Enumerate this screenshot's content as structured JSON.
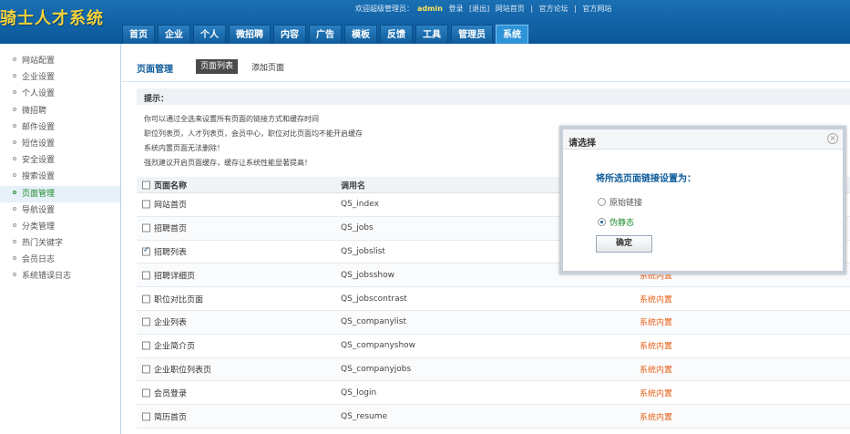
{
  "app": {
    "logo": "骑士人才系统"
  },
  "topbar": {
    "welcome": "欢迎超级管理员：",
    "admin_name": "admin",
    "login": "登录",
    "logout": "[退出]",
    "links": [
      "网站首页",
      "|",
      "官方论坛",
      "|",
      "官方网站"
    ]
  },
  "nav": [
    "首页",
    "企业",
    "个人",
    "微招聘",
    "内容",
    "广告",
    "模板",
    "反馈",
    "工具",
    "管理员",
    "系统"
  ],
  "nav_active": "系统",
  "sidebar": {
    "items": [
      "网站配置",
      "企业设置",
      "个人设置",
      "微招聘",
      "邮件设置",
      "短信设置",
      "安全设置",
      "搜索设置",
      "页面管理",
      "导航设置",
      "分类管理",
      "热门关键字",
      "会员日志",
      "系统错误日志"
    ],
    "active": "页面管理"
  },
  "main": {
    "title": "页面管理",
    "tab_list": "页面列表",
    "tab_add": "添加页面",
    "tip_title": "提示：",
    "tips": [
      "你可以通过全选来设置所有页面的链接方式和缓存时间",
      "职位列表页，人才列表页，会员中心，职位对比页面均不能开启缓存",
      "系统内置页面无法删除！",
      "强烈建议开启页面缓存，缓存让系统性能显著提高！"
    ],
    "table": {
      "headers": [
        "页面名称",
        "调用名"
      ],
      "rows": [
        {
          "name": "网站首页",
          "call": "QS_index",
          "type": "",
          "checked": false
        },
        {
          "name": "招聘首页",
          "call": "QS_jobs",
          "type": "",
          "checked": false
        },
        {
          "name": "招聘列表",
          "call": "QS_jobslist",
          "type": "",
          "checked": true
        },
        {
          "name": "招聘详细页",
          "call": "QS_jobsshow",
          "type": "系统内置",
          "checked": false
        },
        {
          "name": "职位对比页面",
          "call": "QS_jobscontrast",
          "type": "系统内置",
          "checked": false
        },
        {
          "name": "企业列表",
          "call": "QS_companylist",
          "type": "系统内置",
          "checked": false
        },
        {
          "name": "企业简介页",
          "call": "QS_companyshow",
          "type": "系统内置",
          "checked": false
        },
        {
          "name": "企业职位列表页",
          "call": "QS_companyjobs",
          "type": "系统内置",
          "checked": false
        },
        {
          "name": "会员登录",
          "call": "QS_login",
          "type": "系统内置",
          "checked": false
        },
        {
          "name": "简历首页",
          "call": "QS_resume",
          "type": "系统内置",
          "checked": false
        }
      ]
    }
  },
  "dialog": {
    "title": "请选择",
    "close": "×",
    "question": "将所选页面链接设置为：",
    "options": [
      {
        "label": "原始链接",
        "selected": false
      },
      {
        "label": "伪静态",
        "selected": true
      }
    ],
    "confirm": "确定"
  }
}
